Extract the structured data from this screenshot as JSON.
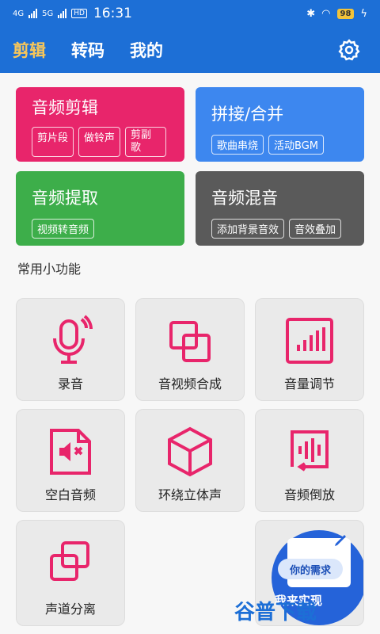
{
  "status": {
    "network1": "4G",
    "network2": "5G",
    "hd": "HD",
    "time": "16:31",
    "battery": "98"
  },
  "header": {
    "tabs": [
      "剪辑",
      "转码",
      "我的"
    ]
  },
  "cards": [
    {
      "title": "音频剪辑",
      "chips": [
        "剪片段",
        "做铃声",
        "剪副歌"
      ],
      "color": "#e8256b"
    },
    {
      "title": "拼接/合并",
      "chips": [
        "歌曲串烧",
        "活动BGM"
      ],
      "color": "#3d87ef"
    },
    {
      "title": "音频提取",
      "chips": [
        "视频转音频"
      ],
      "color": "#3dae4a"
    },
    {
      "title": "音频混音",
      "chips": [
        "添加背景音效",
        "音效叠加"
      ],
      "color": "#5a5a5a"
    }
  ],
  "section_title": "常用小功能",
  "tools": [
    {
      "label": "录音",
      "icon": "microphone-icon"
    },
    {
      "label": "音视频合成",
      "icon": "merge-squares-icon"
    },
    {
      "label": "音量调节",
      "icon": "volume-bars-icon"
    },
    {
      "label": "空白音频",
      "icon": "mute-file-icon"
    },
    {
      "label": "环绕立体声",
      "icon": "cube-icon"
    },
    {
      "label": "音频倒放",
      "icon": "waveform-reverse-icon"
    },
    {
      "label": "声道分离",
      "icon": "split-squares-icon"
    }
  ],
  "promo": {
    "need": "你的需求",
    "implement": "我来实现"
  },
  "watermark": "谷普下载",
  "accent": "#e8256b",
  "brand": "#1d6fd6"
}
